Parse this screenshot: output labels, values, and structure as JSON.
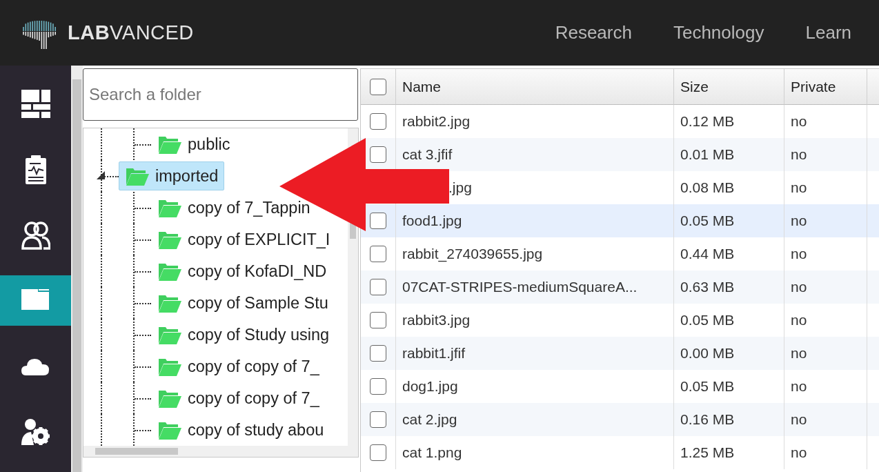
{
  "header": {
    "logo": "**LAB**VANCED",
    "nav": [
      "Research",
      "Technology",
      "Learn"
    ]
  },
  "sidebar": {
    "items": [
      {
        "kind": "dashboard",
        "selected": false
      },
      {
        "kind": "clipboard",
        "selected": false
      },
      {
        "kind": "users",
        "selected": false
      },
      {
        "kind": "folder",
        "selected": true
      },
      {
        "kind": "cloud",
        "selected": false
      },
      {
        "kind": "settings",
        "selected": false
      }
    ]
  },
  "folder_panel": {
    "search": {
      "placeholder": "Search a folder"
    },
    "tree": [
      {
        "children": [
          {
            "label": "public",
            "selected": false
          }
        ]
      },
      {
        "label": "imported",
        "selected": true,
        "expanded": true,
        "children": [
          {
            "label": "copy of 7_Tappin",
            "selected": false
          },
          {
            "label": "copy of EXPLICIT_I",
            "selected": false
          },
          {
            "label": "copy of KofaDI_ND",
            "selected": false
          },
          {
            "label": "copy of Sample Stu",
            "selected": false
          },
          {
            "label": "copy of Study using",
            "selected": false
          },
          {
            "label": "copy of copy of 7_",
            "selected": false
          },
          {
            "label": "copy of copy of 7_",
            "selected": false
          },
          {
            "label": "copy of study abou",
            "selected": false
          }
        ]
      }
    ]
  },
  "table": {
    "select_all": false,
    "columns": [
      "Name",
      "Size",
      "Private"
    ],
    "rows": [
      {
        "checked": false,
        "highlighted": false,
        "name": "rabbit2.jpg",
        "size": "0.12 MB",
        "private": "no"
      },
      {
        "checked": false,
        "highlighted": false,
        "name": "cat 3.jfif",
        "size": "0.01 MB",
        "private": "no"
      },
      {
        "highlighted": false,
        "name": ".jpg",
        "size": "0.08 MB",
        "private": "no"
      },
      {
        "checked": false,
        "highlighted": true,
        "name": "food1.jpg",
        "size": "0.05 MB",
        "private": "no"
      },
      {
        "checked": false,
        "highlighted": false,
        "name": "rabbit_274039655.jpg",
        "size": "0.44 MB",
        "private": "no"
      },
      {
        "checked": false,
        "highlighted": false,
        "name": "07CAT-STRIPES-mediumSquareA...",
        "size": "0.63 MB",
        "private": "no"
      },
      {
        "checked": false,
        "highlighted": false,
        "name": "rabbit3.jpg",
        "size": "0.05 MB",
        "private": "no"
      },
      {
        "checked": false,
        "highlighted": false,
        "name": "rabbit1.jfif",
        "size": "0.00 MB",
        "private": "no"
      },
      {
        "checked": false,
        "highlighted": false,
        "name": "dog1.jpg",
        "size": "0.05 MB",
        "private": "no"
      },
      {
        "checked": false,
        "highlighted": false,
        "name": "cat 2.jpg",
        "size": "0.16 MB",
        "private": "no"
      },
      {
        "checked": false,
        "highlighted": false,
        "name": "cat 1.png",
        "size": "1.25 MB",
        "private": "no"
      }
    ]
  }
}
